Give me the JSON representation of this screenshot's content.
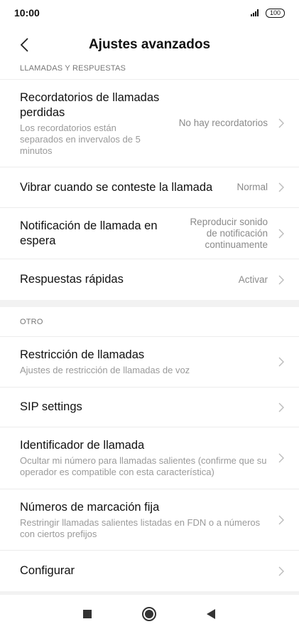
{
  "status_bar": {
    "time": "10:00",
    "battery": "100"
  },
  "header": {
    "title": "Ajustes avanzados",
    "back_icon": "chevron-left-icon"
  },
  "sections": [
    {
      "header": "LLAMADAS Y RESPUESTAS",
      "items": [
        {
          "title": "Recordatorios de llamadas perdidas",
          "subtitle": "Los recordatorios están separados en invervalos de 5 minutos",
          "value": "No hay recordatorios"
        },
        {
          "title": "Vibrar cuando se conteste la llamada",
          "subtitle": "",
          "value": "Normal"
        },
        {
          "title": "Notificación de llamada en espera",
          "subtitle": "",
          "value": "Reproducir sonido de notificación continuamente"
        },
        {
          "title": "Respuestas rápidas",
          "subtitle": "",
          "value": "Activar"
        }
      ]
    },
    {
      "header": "OTRO",
      "items": [
        {
          "title": "Restricción de llamadas",
          "subtitle": "Ajustes de restricción de llamadas de voz",
          "value": ""
        },
        {
          "title": "SIP settings",
          "subtitle": "",
          "value": ""
        },
        {
          "title": "Identificador de llamada",
          "subtitle": "Ocultar mi número para llamadas salientes (confirme que su operador es compatible con esta característica)",
          "value": ""
        },
        {
          "title": "Números de marcación fija",
          "subtitle": "Restringir llamadas salientes listadas en FDN o a números con ciertos prefijos",
          "value": ""
        },
        {
          "title": "Configurar",
          "subtitle": "",
          "value": ""
        }
      ]
    }
  ],
  "nav": {
    "recents_icon": "square-icon",
    "home_icon": "circle-icon",
    "back_icon": "triangle-back-icon"
  }
}
